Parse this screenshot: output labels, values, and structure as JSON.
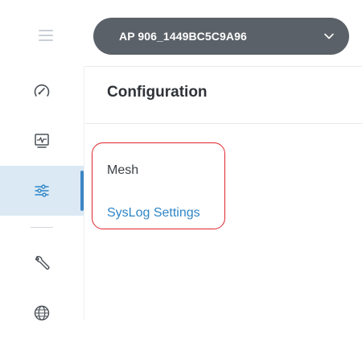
{
  "header": {
    "device_selector": {
      "label": "AP 906_1449BC5C9A96"
    }
  },
  "sidebar": {
    "items": [
      {
        "name": "dashboard",
        "icon": "speedometer-icon"
      },
      {
        "name": "monitoring",
        "icon": "pulse-monitor-icon"
      },
      {
        "name": "configuration",
        "icon": "sliders-icon",
        "active": true
      },
      {
        "name": "tools",
        "icon": "wrench-icon"
      },
      {
        "name": "network",
        "icon": "globe-icon"
      }
    ]
  },
  "main": {
    "section_title": "Configuration",
    "menu": [
      {
        "label": "Mesh"
      },
      {
        "label": "SysLog Settings"
      }
    ]
  },
  "colors": {
    "accent": "#2f86c7",
    "active_bg": "#dbe9f4",
    "selector_bg": "#5b6168",
    "highlight_box": "#e0242b"
  }
}
